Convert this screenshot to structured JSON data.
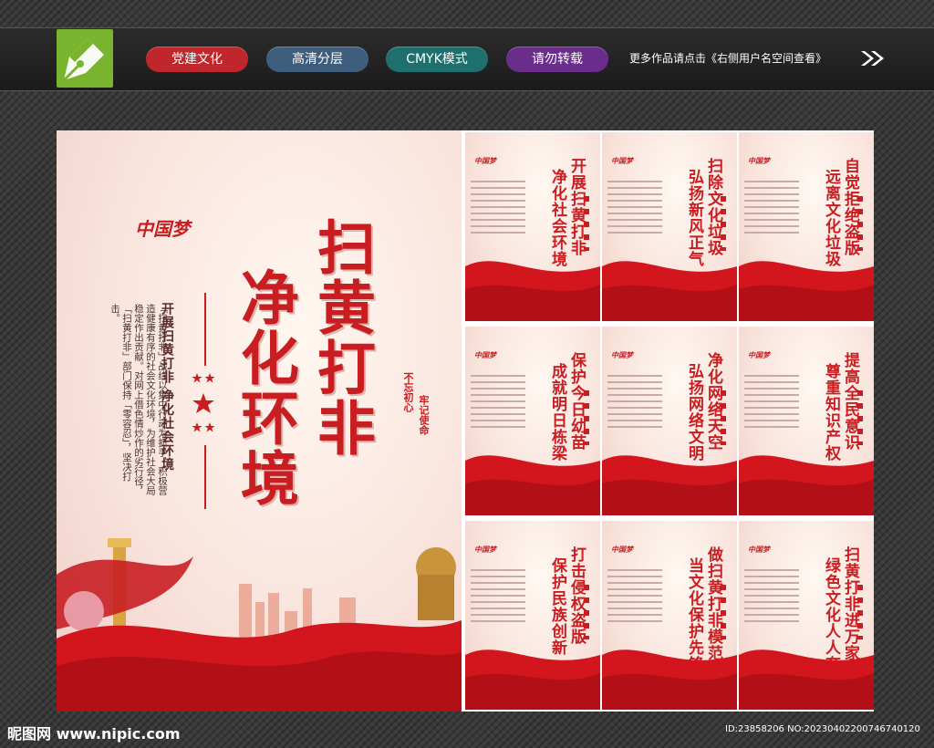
{
  "header": {
    "tags": [
      {
        "label": "党建文化",
        "color": "#c0272d"
      },
      {
        "label": "高清分层",
        "color": "#3f5d7c"
      },
      {
        "label": "CMYK模式",
        "color": "#1f6f6e"
      },
      {
        "label": "请勿转载",
        "color": "#6a2d8c"
      }
    ],
    "tip": "更多作品请点击《右侧用户名空间查看》"
  },
  "main_poster": {
    "logo": "中国梦",
    "title_line1": "扫黄打非",
    "title_line2": "净化环境",
    "subtitle": "开展扫黄打非 净化社会环境",
    "body": "「扫黄打非」战线以集中行动为抓手，积极营造健康有序的社会文化环境，为维护社会大局稳定作出贡献。对网上借色情炒作的劣行径，「扫黄打非」部门保持「零容忍」，坚决打击。",
    "motto1": "不忘初心",
    "motto2": "牢记使命"
  },
  "posters": [
    {
      "line1": "开展扫黄打非",
      "line2": "净化社会环境"
    },
    {
      "line1": "扫除文化垃圾",
      "line2": "弘扬新风正气"
    },
    {
      "line1": "自觉拒绝盗版",
      "line2": "远离文化垃圾"
    },
    {
      "line1": "保护今日幼苗",
      "line2": "成就明日栋梁"
    },
    {
      "line1": "净化网络天空",
      "line2": "弘扬网络文明"
    },
    {
      "line1": "提高全民意识",
      "line2": "尊重知识产权"
    },
    {
      "line1": "打击侵权盗版",
      "line2": "保护民族创新"
    },
    {
      "line1": "做扫黄打非模范",
      "line2": "当文化保护先锋"
    },
    {
      "line1": "扫黄打非进万家",
      "line2": "绿色文化人人夸"
    }
  ],
  "footer": {
    "site": "昵图网 www.nipic.com",
    "id": "ID:23858206 NO:20230402200746740120"
  }
}
